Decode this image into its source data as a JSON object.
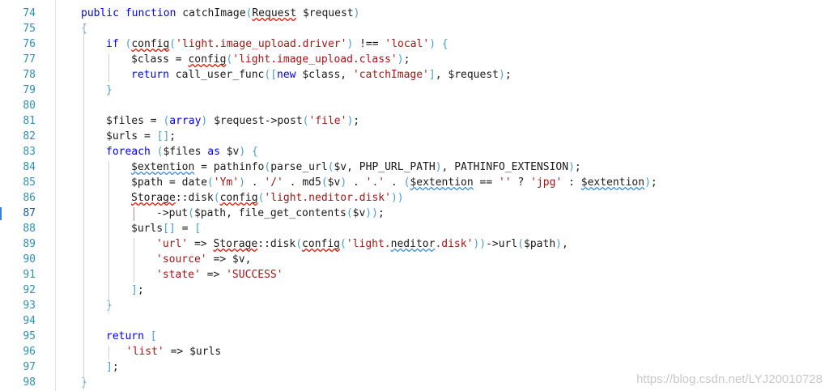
{
  "editor": {
    "line_numbers": [
      "74",
      "75",
      "76",
      "77",
      "78",
      "79",
      "80",
      "81",
      "82",
      "83",
      "84",
      "85",
      "86",
      "87",
      "88",
      "89",
      "90",
      "91",
      "92",
      "93",
      "94",
      "95",
      "96",
      "97",
      "98"
    ],
    "current_line": "87",
    "lines": [
      {
        "indent": 0,
        "tokens": [
          [
            "kw",
            "public "
          ],
          [
            "kw",
            "function "
          ],
          [
            "",
            "catchImage"
          ],
          [
            "br",
            "("
          ],
          [
            "sq",
            "Request"
          ],
          [
            "",
            " $request"
          ],
          [
            "br",
            ")"
          ]
        ]
      },
      {
        "indent": 0,
        "tokens": [
          [
            "br",
            "{"
          ]
        ]
      },
      {
        "indent": 1,
        "tokens": [
          [
            "kw",
            "if "
          ],
          [
            "br",
            "("
          ],
          [
            "sq",
            "config"
          ],
          [
            "br",
            "("
          ],
          [
            "str",
            "'light.image_upload.driver'"
          ],
          [
            "br",
            ")"
          ],
          [
            "",
            " !== "
          ],
          [
            "str",
            "'local'"
          ],
          [
            "br",
            ")"
          ],
          [
            "",
            " "
          ],
          [
            "br",
            "{"
          ]
        ]
      },
      {
        "indent": 2,
        "tokens": [
          [
            "",
            "$class = "
          ],
          [
            "sq",
            "config"
          ],
          [
            "br",
            "("
          ],
          [
            "str",
            "'light.image_upload.class'"
          ],
          [
            "br",
            ")"
          ],
          [
            "",
            ";"
          ]
        ]
      },
      {
        "indent": 2,
        "tokens": [
          [
            "kw",
            "return "
          ],
          [
            "",
            "call_user_func"
          ],
          [
            "br",
            "(["
          ],
          [
            "kw",
            "new "
          ],
          [
            "",
            "$class, "
          ],
          [
            "str",
            "'catchImage'"
          ],
          [
            "br",
            "]"
          ],
          [
            "",
            ", $request"
          ],
          [
            "br",
            ")"
          ],
          [
            "",
            ";"
          ]
        ]
      },
      {
        "indent": 1,
        "tokens": [
          [
            "br",
            "}"
          ]
        ]
      },
      {
        "indent": 0,
        "tokens": []
      },
      {
        "indent": 1,
        "tokens": [
          [
            "",
            "$files = "
          ],
          [
            "br",
            "("
          ],
          [
            "kw",
            "array"
          ],
          [
            "br",
            ")"
          ],
          [
            "",
            " $request->post"
          ],
          [
            "br",
            "("
          ],
          [
            "str",
            "'file'"
          ],
          [
            "br",
            ")"
          ],
          [
            "",
            ";"
          ]
        ]
      },
      {
        "indent": 1,
        "tokens": [
          [
            "",
            "$urls = "
          ],
          [
            "br",
            "[]"
          ],
          [
            "",
            ";"
          ]
        ]
      },
      {
        "indent": 1,
        "tokens": [
          [
            "kw",
            "foreach "
          ],
          [
            "br",
            "("
          ],
          [
            "",
            "$files "
          ],
          [
            "kw",
            "as "
          ],
          [
            "",
            "$v"
          ],
          [
            "br",
            ")"
          ],
          [
            "",
            " "
          ],
          [
            "br",
            "{"
          ]
        ]
      },
      {
        "indent": 2,
        "tokens": [
          [
            "sqb",
            "$extention"
          ],
          [
            "",
            " = pathinfo"
          ],
          [
            "br",
            "("
          ],
          [
            "",
            "parse_url"
          ],
          [
            "br",
            "("
          ],
          [
            "",
            "$v, PHP_URL_PATH"
          ],
          [
            "br",
            ")"
          ],
          [
            "",
            ", PATHINFO_EXTENSION"
          ],
          [
            "br",
            ")"
          ],
          [
            "",
            ";"
          ]
        ]
      },
      {
        "indent": 2,
        "tokens": [
          [
            "",
            "$path = date"
          ],
          [
            "br",
            "("
          ],
          [
            "str",
            "'Ym'"
          ],
          [
            "br",
            ")"
          ],
          [
            "",
            " . "
          ],
          [
            "str",
            "'/'"
          ],
          [
            "",
            " . md5"
          ],
          [
            "br",
            "("
          ],
          [
            "",
            "$v"
          ],
          [
            "br",
            ")"
          ],
          [
            "",
            " . "
          ],
          [
            "str",
            "'.'"
          ],
          [
            "",
            " . "
          ],
          [
            "br",
            "("
          ],
          [
            "sqb",
            "$extention"
          ],
          [
            "",
            " == "
          ],
          [
            "str",
            "''"
          ],
          [
            "",
            " ? "
          ],
          [
            "str",
            "'jpg'"
          ],
          [
            "",
            " : "
          ],
          [
            "sqb",
            "$extention"
          ],
          [
            "br",
            ")"
          ],
          [
            "",
            ";"
          ]
        ]
      },
      {
        "indent": 2,
        "tokens": [
          [
            "sq",
            "Storage"
          ],
          [
            "",
            "::disk"
          ],
          [
            "br",
            "("
          ],
          [
            "sq",
            "config"
          ],
          [
            "br",
            "("
          ],
          [
            "str",
            "'light.neditor.disk'"
          ],
          [
            "br",
            "))"
          ]
        ]
      },
      {
        "indent": 3,
        "tokens": [
          [
            "",
            "->put"
          ],
          [
            "br",
            "("
          ],
          [
            "",
            "$path, file_get_contents"
          ],
          [
            "br",
            "("
          ],
          [
            "",
            "$v"
          ],
          [
            "br",
            "))"
          ],
          [
            "",
            ";"
          ]
        ]
      },
      {
        "indent": 2,
        "tokens": [
          [
            "",
            "$urls"
          ],
          [
            "br",
            "[]"
          ],
          [
            "",
            " = "
          ],
          [
            "br",
            "["
          ]
        ]
      },
      {
        "indent": 3,
        "tokens": [
          [
            "str",
            "'url'"
          ],
          [
            "",
            " => "
          ],
          [
            "sq",
            "Storage"
          ],
          [
            "",
            "::disk"
          ],
          [
            "br",
            "("
          ],
          [
            "sq",
            "config"
          ],
          [
            "br",
            "("
          ],
          [
            "str",
            "'light."
          ],
          [
            "sqb",
            "neditor"
          ],
          [
            "str",
            ".disk'"
          ],
          [
            "br",
            "))"
          ],
          [
            "",
            "->url"
          ],
          [
            "br",
            "("
          ],
          [
            "",
            "$path"
          ],
          [
            "br",
            ")"
          ],
          [
            "",
            ","
          ]
        ]
      },
      {
        "indent": 3,
        "tokens": [
          [
            "str",
            "'source'"
          ],
          [
            "",
            " => $v,"
          ]
        ]
      },
      {
        "indent": 3,
        "tokens": [
          [
            "str",
            "'state'"
          ],
          [
            "",
            " => "
          ],
          [
            "str",
            "'SUCCESS'"
          ]
        ]
      },
      {
        "indent": 2,
        "tokens": [
          [
            "br",
            "]"
          ],
          [
            "",
            ";"
          ]
        ]
      },
      {
        "indent": 1,
        "tokens": [
          [
            "br",
            "}"
          ]
        ]
      },
      {
        "indent": 0,
        "tokens": []
      },
      {
        "indent": 1,
        "tokens": [
          [
            "kw",
            "return "
          ],
          [
            "br",
            "["
          ]
        ]
      },
      {
        "indent": 1.8,
        "tokens": [
          [
            "str",
            "'list'"
          ],
          [
            "",
            " => $urls"
          ]
        ]
      },
      {
        "indent": 1,
        "tokens": [
          [
            "br",
            "]"
          ],
          [
            "",
            ";"
          ]
        ]
      },
      {
        "indent": 0,
        "tokens": [
          [
            "br",
            "}"
          ]
        ]
      }
    ]
  },
  "watermark": "https://blog.csdn.net/LYJ20010728"
}
